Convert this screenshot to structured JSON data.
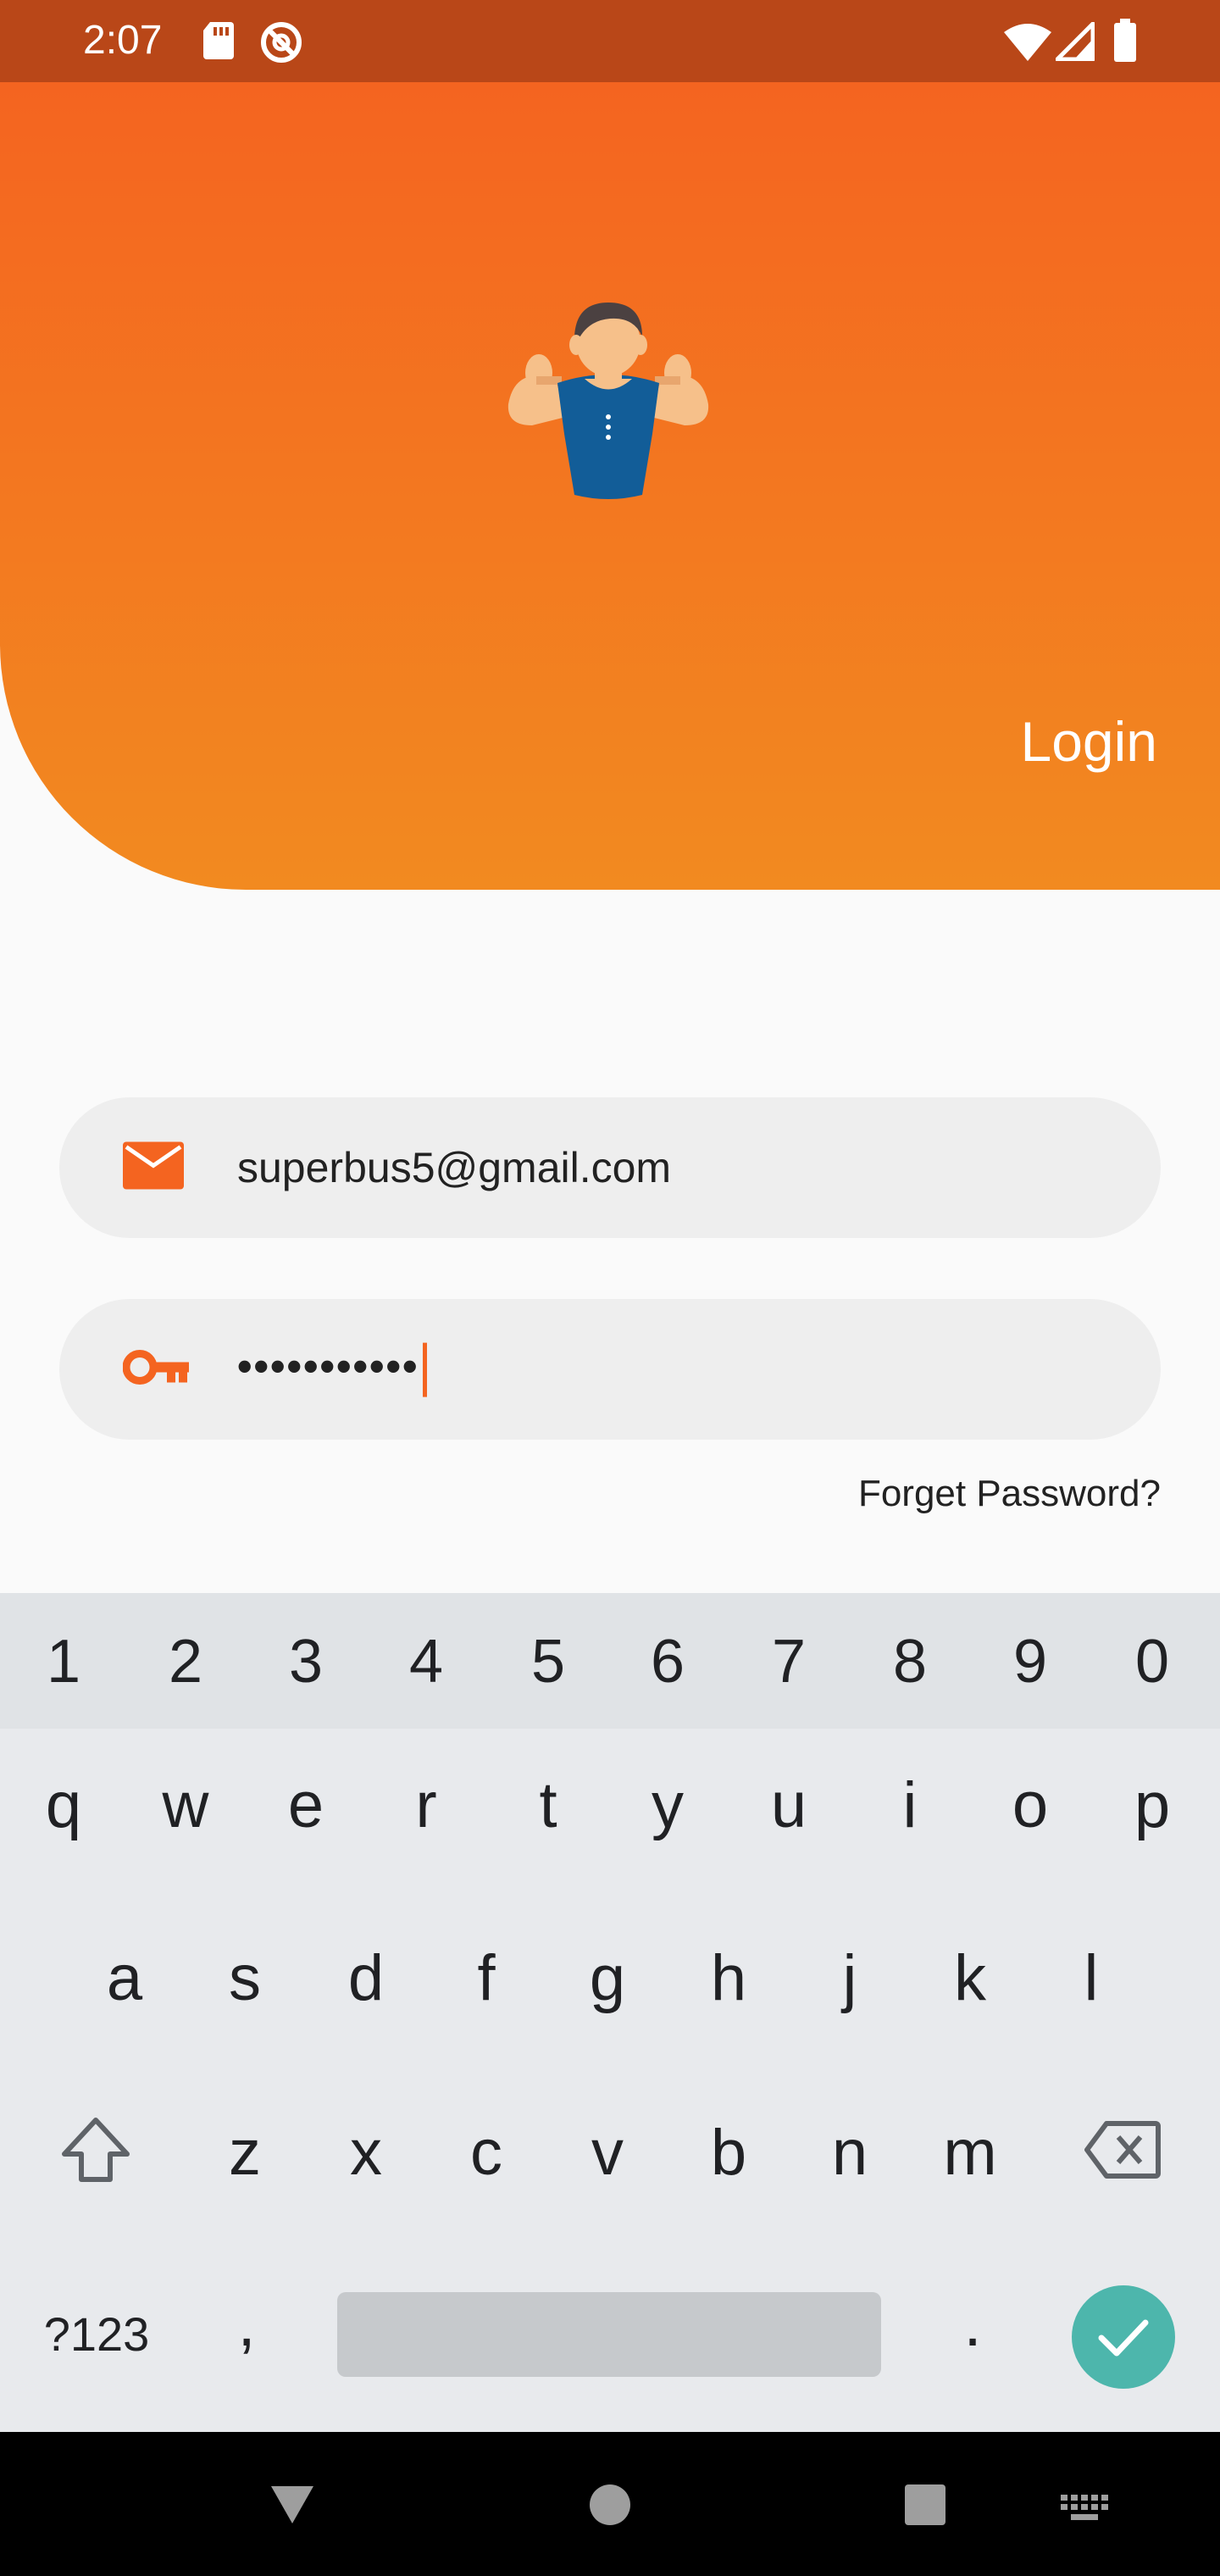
{
  "status_bar": {
    "time": "2:07",
    "left_icons": [
      "sd-card-icon",
      "do-not-disturb-icon"
    ],
    "right_icons": [
      "wifi-icon",
      "signal-icon",
      "battery-icon"
    ]
  },
  "header": {
    "title": "Login",
    "mascot": "muscle-man-icon",
    "gradient": [
      "#f46420",
      "#f28a20"
    ]
  },
  "form": {
    "email": {
      "icon": "mail-icon",
      "value": "superbus5@gmail.com"
    },
    "password": {
      "icon": "key-icon",
      "value": "•••••••••••"
    },
    "forget_label": "Forget Password?"
  },
  "keyboard": {
    "numbers": [
      "1",
      "2",
      "3",
      "4",
      "5",
      "6",
      "7",
      "8",
      "9",
      "0"
    ],
    "row1": [
      "q",
      "w",
      "e",
      "r",
      "t",
      "y",
      "u",
      "i",
      "o",
      "p"
    ],
    "row2": [
      "a",
      "s",
      "d",
      "f",
      "g",
      "h",
      "j",
      "k",
      "l"
    ],
    "row3": [
      "z",
      "x",
      "c",
      "v",
      "b",
      "n",
      "m"
    ],
    "symbols_key": "?123",
    "comma": ",",
    "period": ".",
    "icons": [
      "shift-icon",
      "backspace-icon",
      "check-icon"
    ]
  },
  "nav_bar": {
    "icons": [
      "back-icon",
      "home-icon",
      "recents-icon",
      "keyboard-switch-icon"
    ]
  },
  "colors": {
    "status_bar": "#b94718",
    "accent": "#f46420",
    "enter_key": "#4db6ac"
  }
}
